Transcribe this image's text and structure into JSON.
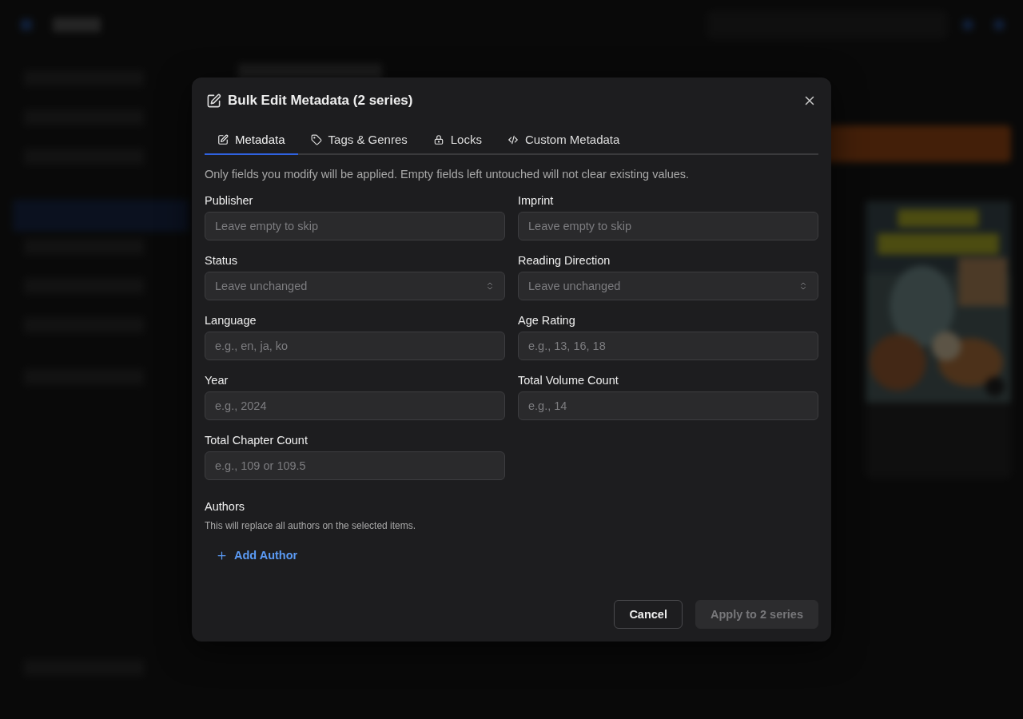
{
  "dialog": {
    "title": "Bulk Edit Metadata (2 series)",
    "tabs": [
      {
        "label": "Metadata",
        "selected": true
      },
      {
        "label": "Tags & Genres",
        "selected": false
      },
      {
        "label": "Locks",
        "selected": false
      },
      {
        "label": "Custom Metadata",
        "selected": false
      }
    ],
    "notice": "Only fields you modify will be applied. Empty fields left untouched will not clear existing values.",
    "fields": [
      {
        "label": "Publisher",
        "kind": "text",
        "placeholder": "Leave empty to skip"
      },
      {
        "label": "Imprint",
        "kind": "text",
        "placeholder": "Leave empty to skip"
      },
      {
        "label": "Status",
        "kind": "select",
        "placeholder": "Leave unchanged"
      },
      {
        "label": "Reading Direction",
        "kind": "select",
        "placeholder": "Leave unchanged"
      },
      {
        "label": "Language",
        "kind": "text",
        "placeholder": "e.g., en, ja, ko"
      },
      {
        "label": "Age Rating",
        "kind": "text",
        "placeholder": "e.g., 13, 16, 18"
      },
      {
        "label": "Year",
        "kind": "text",
        "placeholder": "e.g., 2024"
      },
      {
        "label": "Total Volume Count",
        "kind": "text",
        "placeholder": "e.g., 14"
      },
      {
        "label": "Total Chapter Count",
        "kind": "text",
        "placeholder": "e.g., 109 or 109.5"
      }
    ],
    "authors": {
      "label": "Authors",
      "hint": "This will replace all authors on the selected items.",
      "add_label": "Add Author"
    },
    "buttons": [
      {
        "kind": "cancel",
        "label": "Cancel"
      },
      {
        "kind": "apply",
        "label": "Apply to 2 series",
        "disabled": true
      }
    ]
  }
}
